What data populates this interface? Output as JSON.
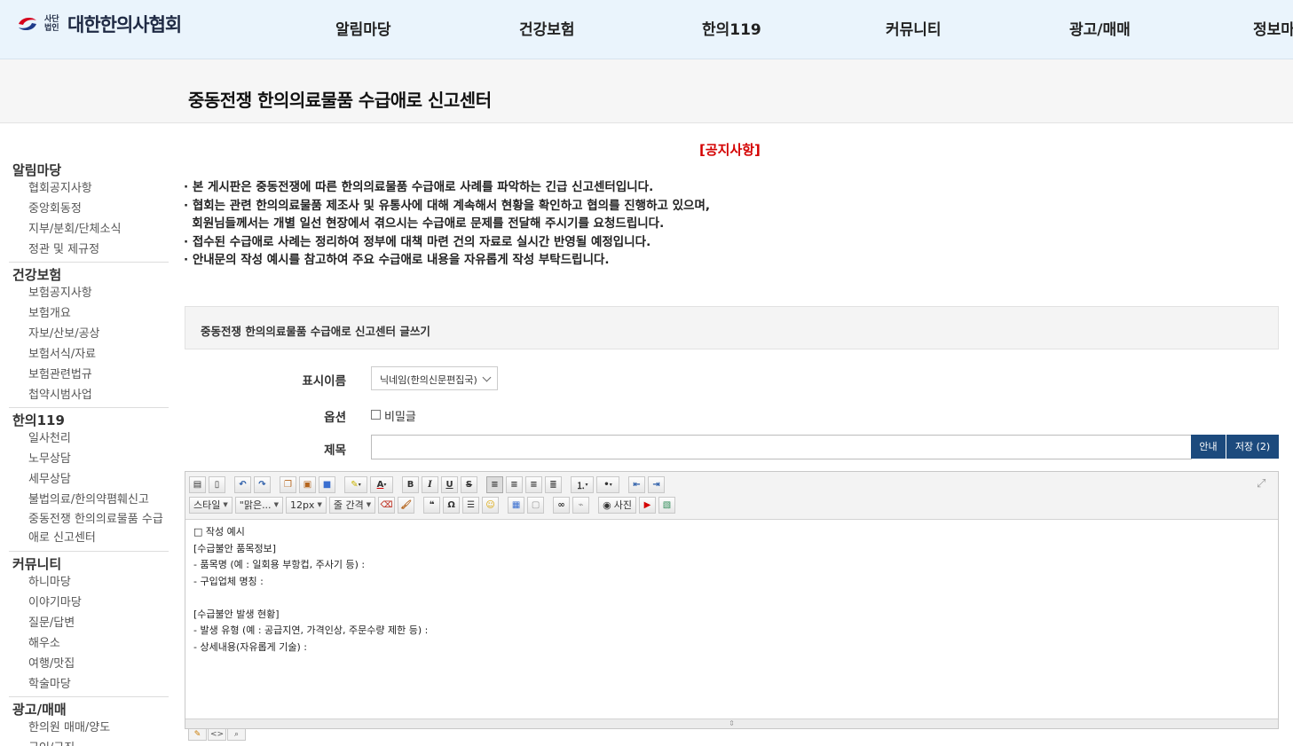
{
  "logo": {
    "small_text": "사단법인",
    "name": "대한한의사협회",
    "colors": {
      "red": "#d6001c",
      "navy": "#1f3a8a"
    }
  },
  "nav": {
    "items": [
      "알림마당",
      "건강보험",
      "한의119",
      "커뮤니티",
      "광고/매매",
      "정보마"
    ]
  },
  "page_title": "중동전쟁 한의의료물품 수급애로 신고센터",
  "sidebar": {
    "groups": [
      {
        "title": "알림마당",
        "items": [
          "협회공지사항",
          "중앙회동정",
          "지부/분회/단체소식",
          "정관 및 제규정"
        ]
      },
      {
        "title": "건강보험",
        "items": [
          "보험공지사항",
          "보험개요",
          "자보/산보/공상",
          "보험서식/자료",
          "보험관련법규",
          "첩약시범사업"
        ]
      },
      {
        "title": "한의119",
        "items": [
          "일사천리",
          "노무상담",
          "세무상담",
          "불법의료/한의약폄훼신고",
          "중동전쟁 한의의료물품 수급애로 신고센터"
        ]
      },
      {
        "title": "커뮤니티",
        "items": [
          "하니마당",
          "이야기마당",
          "질문/답변",
          "해우소",
          "여행/맛집",
          "학술마당"
        ]
      },
      {
        "title": "광고/매매",
        "items": [
          "한의원 매매/양도",
          "구인/구직"
        ]
      }
    ]
  },
  "notice": {
    "title": "[공지사항]",
    "lines": [
      "· 본 게시판은 중동전쟁에 따른 한의의료물품 수급애로 사례를 파악하는 긴급 신고센터입니다.",
      "· 협회는 관련 한의의료물품 제조사 및 유통사에 대해 계속해서 현황을 확인하고 협의를 진행하고 있으며,",
      "  회원님들께서는 개별 일선 현장에서 겪으시는 수급애로 문제를 전달해 주시기를 요청드립니다.",
      "· 접수된 수급애로 사례는 정리하여 정부에 대책 마련 건의 자료로 실시간 반영될 예정입니다.",
      "· 안내문의 작성 예시를 참고하여 주요 수급애로 내용을 자유롭게 작성 부탁드립니다."
    ]
  },
  "write": {
    "header": "중동전쟁 한의의료물품 수급애로 신고센터 글쓰기",
    "display_name_label": "표시이름",
    "display_name_value": "닉네임(한의신문편집국)",
    "option_label": "옵션",
    "secret_label": "비밀글",
    "subject_label": "제목",
    "subject_value": "",
    "guide_button": "안내",
    "save_button": "저장 (2)"
  },
  "editor": {
    "dropdowns": {
      "style": "스타일",
      "font": "\"맑은...",
      "size": "12px",
      "line": "줄 간격"
    },
    "photo_button": "사진",
    "content_lines": [
      "□ 작성 예시",
      "[수급불안 품목정보]",
      "- 품목명 (예 : 일회용 부항컵, 주사기 등) :",
      "- 구입업체 명칭 :",
      "",
      "[수급불안 발생 현황]",
      "- 발생 유형 (예 : 공급지연, 가격인상, 주문수량 제한 등) :",
      "- 상세내용(자유롭게 기술) :"
    ]
  }
}
